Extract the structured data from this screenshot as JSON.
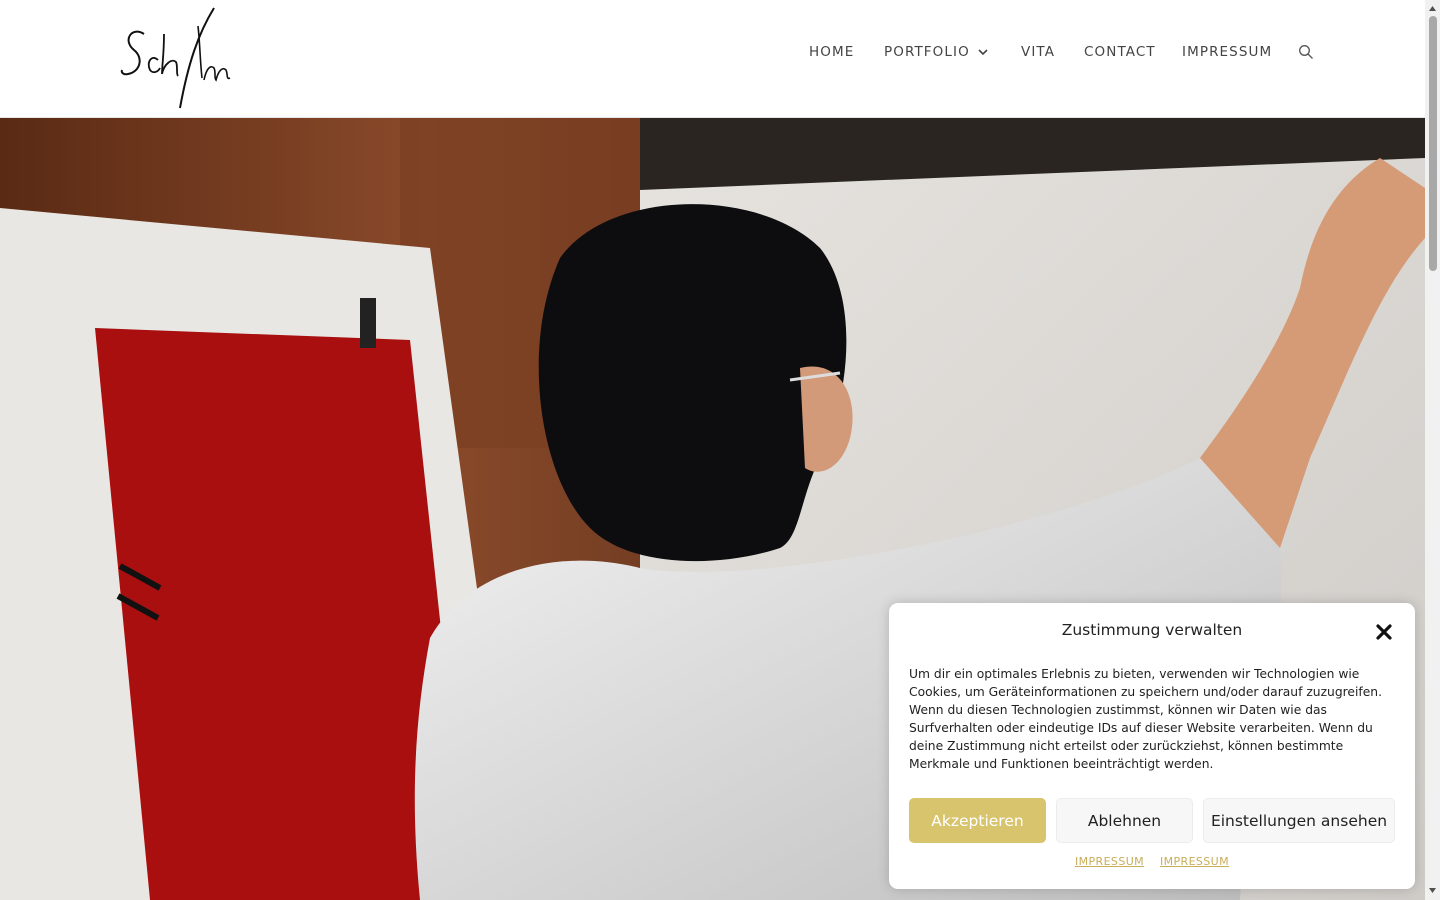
{
  "header": {
    "logo_alt": "Schillum signature logo",
    "nav": [
      {
        "label": "HOME"
      },
      {
        "label": "PORTFOLIO"
      },
      {
        "label": "VITA"
      },
      {
        "label": "CONTACT"
      },
      {
        "label": "IMPRESSUM"
      }
    ],
    "search_icon": "search-icon"
  },
  "hero": {
    "description_icon": "hero-photo"
  },
  "consent": {
    "title": "Zustimmung verwalten",
    "text": "Um dir ein optimales Erlebnis zu bieten, verwenden wir Technologien wie Cookies, um Geräteinformationen zu speichern und/oder darauf zuzugreifen. Wenn du diesen Technologien zustimmst, können wir Daten wie das Surfverhalten oder eindeutige IDs auf dieser Website verarbeiten. Wenn du deine Zustimmung nicht erteilst oder zurückziehst, können bestimmte Merkmale und Funktionen beeinträchtigt werden.",
    "accept_label": "Akzeptieren",
    "deny_label": "Ablehnen",
    "settings_label": "Einstellungen ansehen",
    "links": [
      "IMPRESSUM",
      "IMPRESSUM"
    ]
  },
  "colors": {
    "accent": "#d8c46d",
    "link": "#c8ad5a",
    "nav_text": "#444444"
  }
}
